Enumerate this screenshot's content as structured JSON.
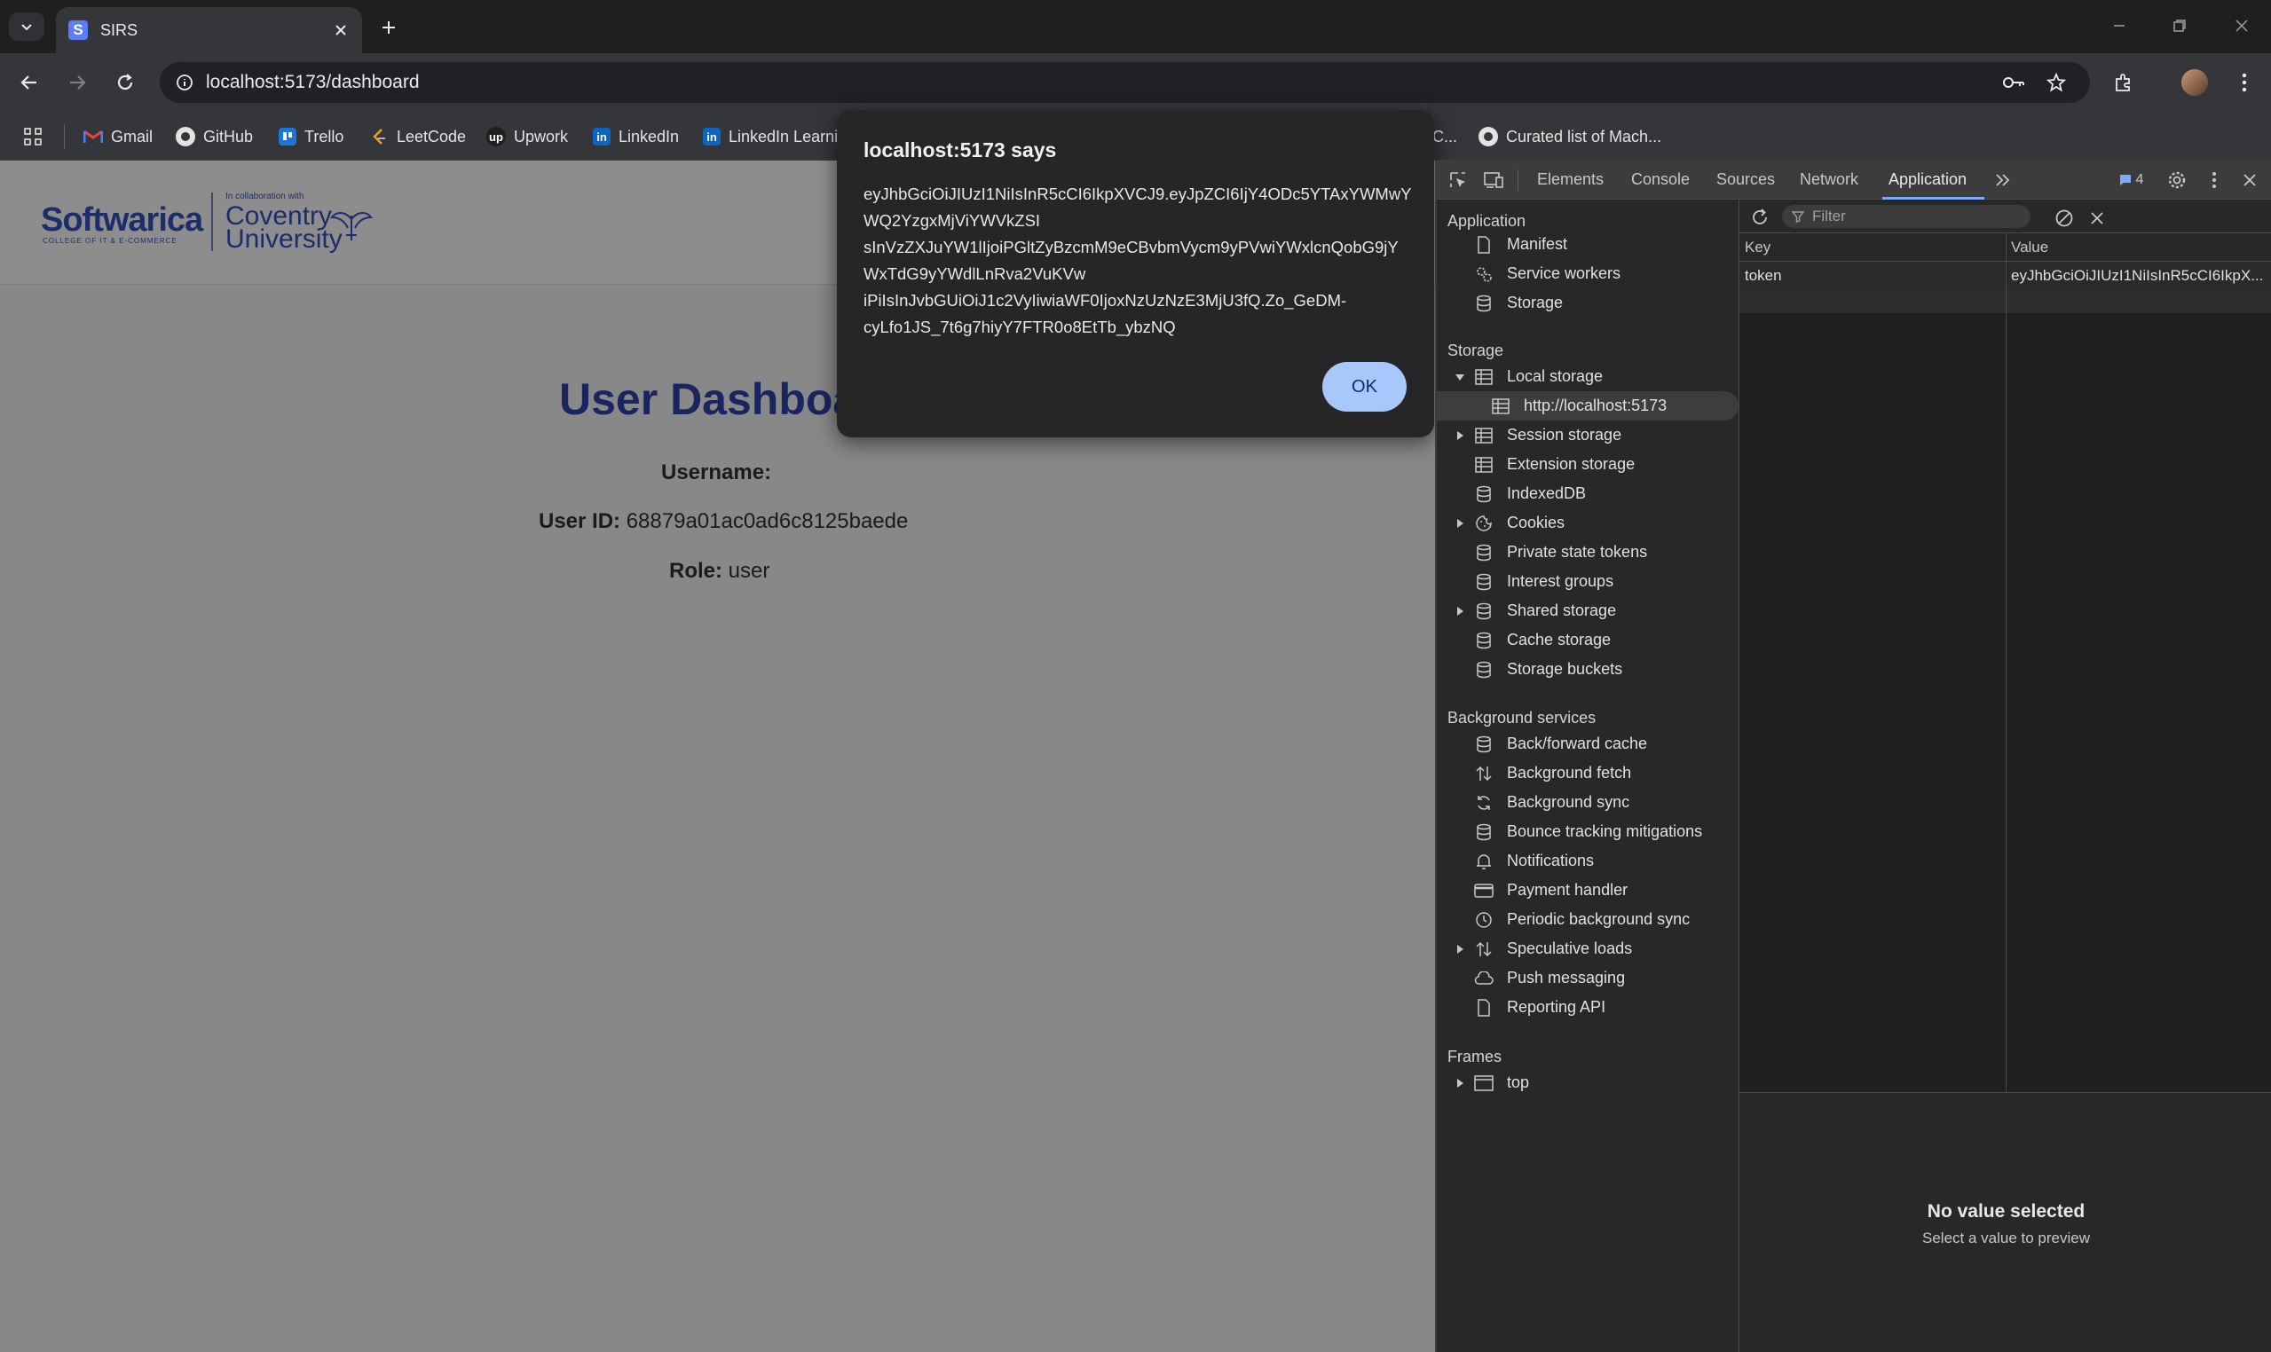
{
  "browser": {
    "tab": {
      "title": "SIRS",
      "favicon_letter": "S"
    },
    "url": "localhost:5173/dashboard",
    "bookmarks": [
      {
        "label": "Gmail",
        "icon": "gmail-icon"
      },
      {
        "label": "GitHub",
        "icon": "github-icon"
      },
      {
        "label": "Trello",
        "icon": "trello-icon"
      },
      {
        "label": "LeetCode",
        "icon": "leetcode-icon"
      },
      {
        "label": "Upwork",
        "icon": "upwork-icon"
      },
      {
        "label": "LinkedIn",
        "icon": "linkedin-icon"
      },
      {
        "label": "LinkedIn Learni",
        "icon": "linkedin-icon"
      },
      {
        "label": "C...",
        "icon": ""
      },
      {
        "label": "Curated list of Mach...",
        "icon": "github-icon"
      }
    ]
  },
  "page": {
    "logo": {
      "brand": "Softwarica",
      "brand_sub": "COLLEGE OF IT & E-COMMERCE",
      "collab": "In collaboration with",
      "university_line1": "Coventry",
      "university_line2": "University"
    },
    "title": "User Dashboa",
    "fields": [
      {
        "label": "Username:",
        "value": ""
      },
      {
        "label": "User ID:",
        "value": "68879a01ac0ad6c8125baede"
      },
      {
        "label": "Role:",
        "value": "user"
      }
    ]
  },
  "alert": {
    "heading": "localhost:5173 says",
    "lines": [
      "eyJhbGciOiJIUzI1NiIsInR5cCI6IkpXVCJ9.eyJpZCI6IjY4ODc5YTAxYWMwY",
      "WQ2YzgxMjViYWVkZSI",
      "sInVzZXJuYW1lIjoiPGltZyBzcmM9eCBvbmVycm9yPVwiYWxlcnQobG9jY",
      "WxTdG9yYWdlLnRva2VuKVw",
      "iPiIsInJvbGUiOiJ1c2VyIiwiaWF0IjoxNzUzNzE3MjU3fQ.Zo_GeDM-",
      "cyLfo1JS_7t6g7hiyY7FTR0o8EtTb_ybzNQ"
    ],
    "ok_label": "OK"
  },
  "devtools": {
    "tabs": [
      "Elements",
      "Console",
      "Sources",
      "Network",
      "Application"
    ],
    "active_tab": "Application",
    "issues_count": "4",
    "sections": {
      "application": {
        "label": "Application",
        "items": [
          "Manifest",
          "Service workers",
          "Storage"
        ]
      },
      "storage": {
        "label": "Storage",
        "items": [
          "Local storage",
          "http://localhost:5173",
          "Session storage",
          "Extension storage",
          "IndexedDB",
          "Cookies",
          "Private state tokens",
          "Interest groups",
          "Shared storage",
          "Cache storage",
          "Storage buckets"
        ]
      },
      "background": {
        "label": "Background services",
        "items": [
          "Back/forward cache",
          "Background fetch",
          "Background sync",
          "Bounce tracking mitigations",
          "Notifications",
          "Payment handler",
          "Periodic background sync",
          "Speculative loads",
          "Push messaging",
          "Reporting API"
        ]
      },
      "frames": {
        "label": "Frames",
        "items": [
          "top"
        ]
      }
    },
    "filter_placeholder": "Filter",
    "table": {
      "headers": [
        "Key",
        "Value"
      ],
      "rows": [
        {
          "key": "token",
          "value": "eyJhbGciOiJIUzI1NiIsInR5cCI6IkpX..."
        }
      ]
    },
    "preview": {
      "title": "No value selected",
      "subtitle": "Select a value to preview"
    }
  }
}
